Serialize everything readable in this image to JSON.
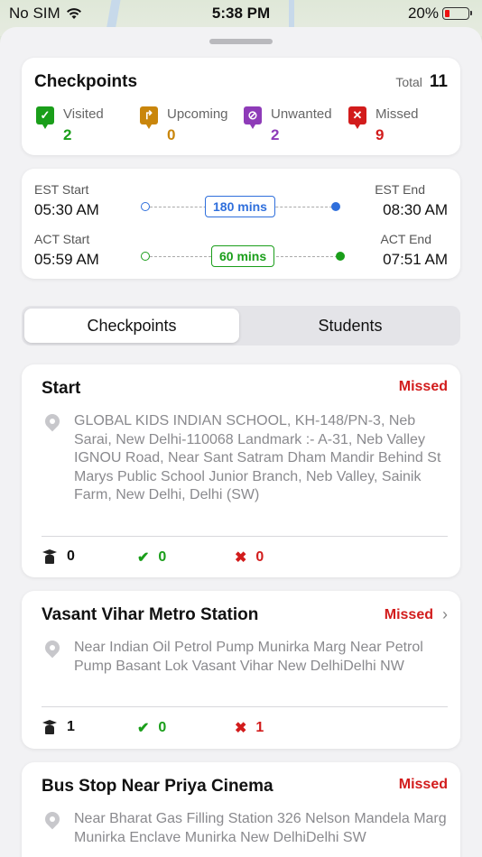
{
  "status_bar": {
    "carrier": "No SIM",
    "time": "5:38 PM",
    "battery": "20%"
  },
  "checkpoints_summary": {
    "title": "Checkpoints",
    "total_label": "Total",
    "total_value": "11",
    "stats": [
      {
        "name": "Visited",
        "value": "2",
        "color": "#1a9e1a",
        "icon": "check-icon"
      },
      {
        "name": "Upcoming",
        "value": "0",
        "color": "#c9860c",
        "icon": "turn-arrow-icon"
      },
      {
        "name": "Unwanted",
        "value": "2",
        "color": "#8e3bb8",
        "icon": "block-icon"
      },
      {
        "name": "Missed",
        "value": "9",
        "color": "#d21c1c",
        "icon": "cross-icon"
      }
    ]
  },
  "timing": {
    "est_start_label": "EST Start",
    "est_start": "05:30 AM",
    "est_end_label": "EST End",
    "est_end": "08:30 AM",
    "est_duration": "180 mins",
    "act_start_label": "ACT Start",
    "act_start": "05:59 AM",
    "act_end_label": "ACT End",
    "act_end": "07:51 AM",
    "act_duration": "60 mins",
    "est_color": "#2f6fdc",
    "act_color": "#1a9e1a"
  },
  "tabs": {
    "checkpoints": "Checkpoints",
    "students": "Students",
    "active": "Checkpoints"
  },
  "stops": [
    {
      "name": "Start",
      "status": "Missed",
      "address": "GLOBAL KIDS INDIAN SCHOOL, KH-148/PN-3, Neb Sarai, New Delhi-110068 Landmark :- A-31, Neb Valley IGNOU Road, Near Sant Satram Dham Mandir Behind St Marys Public School Junior Branch, Neb Valley, Sainik Farm, New Delhi, Delhi (SW)",
      "students": "0",
      "boarded": "0",
      "missed": "0"
    },
    {
      "name": "Vasant Vihar Metro Station",
      "status": "Missed",
      "address": "Near Indian Oil Petrol Pump Munirka Marg Near Petrol Pump Basant Lok Vasant Vihar New DelhiDelhi NW",
      "students": "1",
      "boarded": "0",
      "missed": "1"
    },
    {
      "name": "Bus Stop Near Priya Cinema",
      "status": "Missed",
      "address": "Near Bharat Gas Filling Station 326 Nelson Mandela Marg Munirka Enclave Munirka New DelhiDelhi SW"
    }
  ]
}
